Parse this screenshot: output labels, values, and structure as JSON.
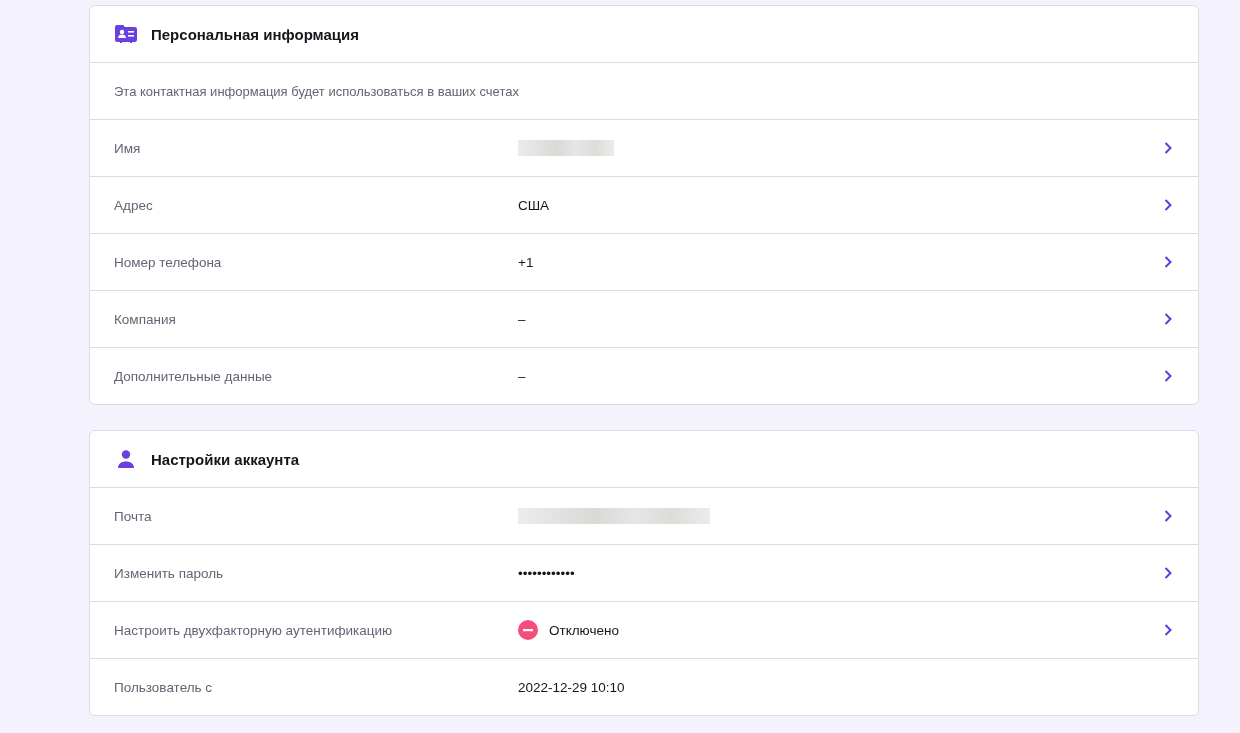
{
  "sections": [
    {
      "title": "Персональная информация",
      "description": "Эта контактная информация будет использоваться в ваших счетах",
      "rows": [
        {
          "label": "Имя",
          "kind": "redacted",
          "link": true
        },
        {
          "label": "Адрес",
          "kind": "text",
          "value": "США",
          "link": true
        },
        {
          "label": "Номер телефона",
          "kind": "text",
          "value": "+1",
          "link": true
        },
        {
          "label": "Компания",
          "kind": "text",
          "value": "–",
          "link": true
        },
        {
          "label": "Дополнительные данные",
          "kind": "text",
          "value": "–",
          "link": true
        }
      ]
    },
    {
      "title": "Настройки аккаунта",
      "rows": [
        {
          "label": "Почта",
          "kind": "redacted",
          "link": true
        },
        {
          "label": "Изменить пароль",
          "kind": "text",
          "value": "••••••••••••",
          "link": true
        },
        {
          "label": "Настроить двухфакторную аутентификацию",
          "kind": "status",
          "value": "Отключено",
          "enabled": false,
          "link": true
        },
        {
          "label": "Пользователь с",
          "kind": "text",
          "value": "2022-12-29 10:10",
          "link": false
        }
      ]
    }
  ]
}
